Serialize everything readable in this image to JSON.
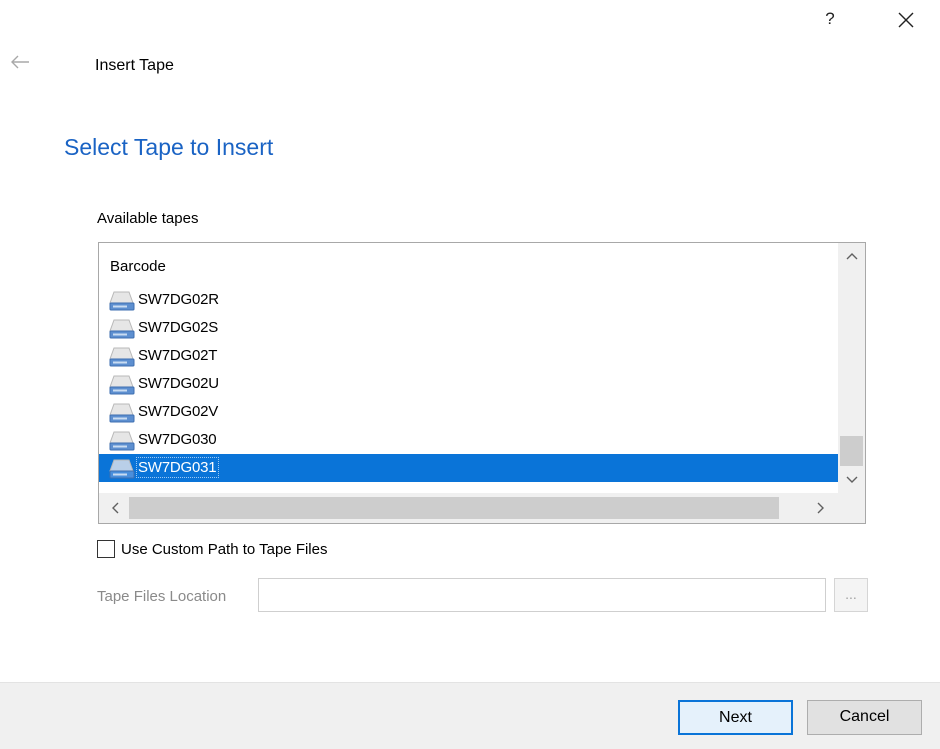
{
  "window": {
    "help_label": "?",
    "title": "Insert Tape"
  },
  "page": {
    "heading": "Select Tape to Insert"
  },
  "tape_list": {
    "label": "Available tapes",
    "column_header": "Barcode",
    "items": [
      {
        "label": "SW7DG02R",
        "selected": false
      },
      {
        "label": "SW7DG02S",
        "selected": false
      },
      {
        "label": "SW7DG02T",
        "selected": false
      },
      {
        "label": "SW7DG02U",
        "selected": false
      },
      {
        "label": "SW7DG02V",
        "selected": false
      },
      {
        "label": "SW7DG030",
        "selected": false
      },
      {
        "label": "SW7DG031",
        "selected": true
      }
    ],
    "scroll_up_glyph": "^",
    "scroll_down_glyph": "v",
    "scroll_left_glyph": "<",
    "scroll_right_glyph": ">"
  },
  "custom_path": {
    "checkbox_label": "Use Custom Path to Tape Files",
    "checked": false
  },
  "location": {
    "label": "Tape Files Location",
    "value": "",
    "browse_label": "..."
  },
  "buttons": {
    "next": "Next",
    "cancel": "Cancel"
  },
  "colors": {
    "heading": "#1a63c4",
    "selection": "#0a74d8",
    "footer": "#f0f0f0",
    "disabled_text": "#8a8a8a"
  },
  "icons": {
    "back": "arrow-left-icon",
    "close": "close-icon",
    "tape": "tape-drive-icon"
  }
}
